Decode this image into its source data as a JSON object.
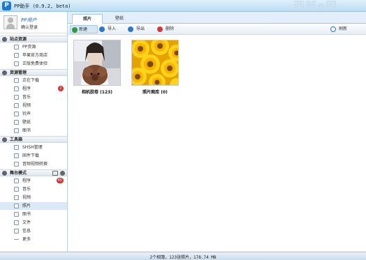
{
  "app": {
    "logo_text": "P",
    "title": "PP助手 (0.9.2, beta)",
    "watermark": "西部e网"
  },
  "user": {
    "name": "PP用户",
    "action": "确认登录"
  },
  "sidebar": {
    "sections": [
      {
        "label": "站点资源"
      },
      {
        "label": "资源管理"
      },
      {
        "label": "工具箱"
      },
      {
        "label": "舞台模式"
      }
    ],
    "site": [
      {
        "label": "PP资源"
      },
      {
        "label": "苹果官方商店"
      },
      {
        "label": "正版免费体验"
      }
    ],
    "manage": [
      {
        "label": "正在下载"
      },
      {
        "label": "程序",
        "badge": "2"
      },
      {
        "label": "音乐"
      },
      {
        "label": "视频"
      },
      {
        "label": "铃声"
      },
      {
        "label": "壁纸"
      },
      {
        "label": "图书"
      }
    ],
    "tools": [
      {
        "label": "SHSH管理"
      },
      {
        "label": "固件下载"
      },
      {
        "label": "音频视频转换"
      }
    ],
    "device": [
      {
        "label": "程序",
        "badge": "45"
      },
      {
        "label": "音乐"
      },
      {
        "label": "视频"
      },
      {
        "label": "照片"
      },
      {
        "label": "图书"
      },
      {
        "label": "文件"
      },
      {
        "label": "信息"
      },
      {
        "label": "更多"
      }
    ]
  },
  "tabs": [
    {
      "label": "照片"
    },
    {
      "label": "壁纸"
    }
  ],
  "toolbar": {
    "new": "新建",
    "import": "导入",
    "export": "导出",
    "delete": "删除",
    "refresh": "刷新"
  },
  "albums": [
    {
      "label": "相机胶卷 (123)"
    },
    {
      "label": "照片图库 (0)"
    }
  ],
  "status": "2个相簿，123张照片，178.74 MB",
  "colors": {
    "accent": "#1b7ad9",
    "badge": "#d73030",
    "sunflower": "#f6b400"
  }
}
